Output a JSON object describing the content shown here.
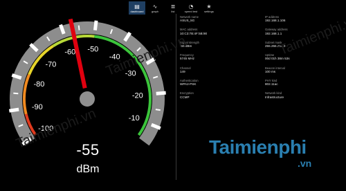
{
  "nav": [
    {
      "label": "dashboard",
      "icon": "dashboard-icon",
      "glyph": "▤",
      "active": true
    },
    {
      "label": "graph",
      "icon": "graph-icon",
      "glyph": "∿",
      "active": false
    },
    {
      "label": "list",
      "icon": "list-icon",
      "glyph": "≣",
      "active": false
    },
    {
      "label": "speed test",
      "icon": "speedometer-icon",
      "glyph": "◔",
      "active": false
    },
    {
      "label": "settings",
      "icon": "gear-icon",
      "glyph": "★",
      "active": false
    }
  ],
  "gauge": {
    "ticks": [
      "-100",
      "-90",
      "-80",
      "-70",
      "-60",
      "-50",
      "-40",
      "-30",
      "-20",
      "-10"
    ],
    "min": -100,
    "max": -5,
    "needle": -57,
    "value": "-55",
    "unit": "dBm",
    "colors": {
      "red": "#e03a1e",
      "orange": "#f08a20",
      "yellow": "#e6d42a",
      "green": "#3bc43b",
      "band": "#8d8d8d",
      "needle": "#e0000f"
    }
  },
  "network_info": {
    "left": [
      {
        "label": "Network name",
        "value": "ASUS_5G"
      },
      {
        "label": "MAC address",
        "value": "10:C3:7B:4F:5B:90"
      },
      {
        "label": "Signal strength",
        "value": "-55 dBm"
      },
      {
        "label": "Frequency",
        "value": "5745 MHz"
      },
      {
        "label": "Channel",
        "value": "149"
      },
      {
        "label": "Authentication",
        "value": "WPA2-PSK"
      },
      {
        "label": "Encryption",
        "value": "CCMP"
      }
    ],
    "right": [
      {
        "label": "IP address",
        "value": "192.168.1.106"
      },
      {
        "label": "Gateway address",
        "value": "192.168.1.1"
      },
      {
        "label": "Subnet mask",
        "value": "255.255.255.0"
      },
      {
        "label": "Uptime",
        "value": "00d 01h 38m 53s"
      },
      {
        "label": "Beacon interval",
        "value": "100 ms"
      },
      {
        "label": "PHY kind",
        "value": "802.11ac"
      },
      {
        "label": "Network kind",
        "value": "Infrastructure"
      }
    ]
  },
  "watermark": {
    "brand": "Taimienphi",
    "suffix": ".vn",
    "faint": "Taimienphi.vn"
  }
}
